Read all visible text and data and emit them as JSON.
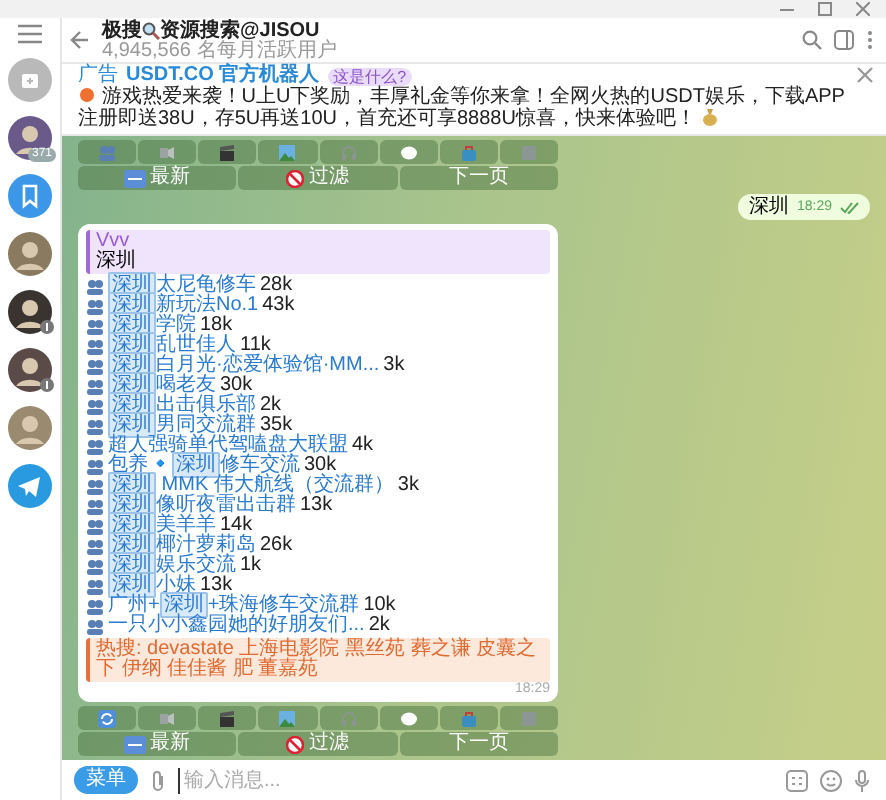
{
  "sidebar": {
    "items": [
      {
        "kind": "archive"
      },
      {
        "kind": "avatar",
        "badge": "371"
      },
      {
        "kind": "saved"
      },
      {
        "kind": "avatar"
      },
      {
        "kind": "avatar",
        "muted": true
      },
      {
        "kind": "avatar",
        "muted": true
      },
      {
        "kind": "avatar"
      },
      {
        "kind": "telegram"
      }
    ]
  },
  "header": {
    "title": [
      "极搜",
      "资源搜索@JISOU"
    ],
    "subtitle": "4,945,566 名每月活跃用户"
  },
  "ad": {
    "label": "广告",
    "name": "USDT.CO 官方机器人",
    "badge": "这是什么?",
    "text": "游戏热爱来袭！U上U下奖励，丰厚礼金等你来拿！全网火热的USDT娱乐，下载APP注册即送38U，存5U再送10U，首充还可享8888U惊喜，快来体验吧！"
  },
  "keyboard_top": {
    "buttons": [
      "最新",
      "过滤",
      "下一页"
    ]
  },
  "outgoing": {
    "text": "深圳",
    "time": "18:29",
    "read": true
  },
  "result": {
    "reply": {
      "author": "Vvv",
      "text": "深圳"
    },
    "items": [
      {
        "match": "深圳",
        "after": "太尼龟修车",
        "count": "28k"
      },
      {
        "match": "深圳",
        "after": "新玩法No.1",
        "count": "43k"
      },
      {
        "match": "深圳",
        "after": "学院",
        "count": "18k"
      },
      {
        "match": "深圳",
        "after": "乱世佳人",
        "count": "11k"
      },
      {
        "match": "深圳",
        "after": "白月光·恋爱体验馆·MM...",
        "count": "3k"
      },
      {
        "match": "深圳",
        "after": "喝老友",
        "count": "30k"
      },
      {
        "match": "深圳",
        "after": "出击俱乐部",
        "count": "2k"
      },
      {
        "match": "深圳",
        "after": "男同交流群",
        "count": "35k"
      },
      {
        "before": "超人强骑单代驾嗑盘大联盟",
        "count": "4k"
      },
      {
        "before": "包养🔹",
        "match": "深圳",
        "after": "修车交流",
        "count": "30k"
      },
      {
        "match": "深圳",
        "after": " MMK 伟大航线（交流群）",
        "count": "3k"
      },
      {
        "match": "深圳",
        "after": "像听夜雷出击群",
        "count": "13k"
      },
      {
        "match": "深圳",
        "after": "美羊羊",
        "count": "14k"
      },
      {
        "match": "深圳",
        "after": "椰汁萝莉岛",
        "count": "26k"
      },
      {
        "match": "深圳",
        "after": "娱乐交流",
        "count": "1k"
      },
      {
        "match": "深圳",
        "after": "小妹",
        "count": "13k"
      },
      {
        "before": "广州+",
        "match": "深圳",
        "after": "+珠海修车交流群",
        "count": "10k"
      },
      {
        "before": "一只小小鑫园她的好朋友们...",
        "count": "2k"
      }
    ],
    "hot": {
      "label": "热搜:",
      "text": "devastate 上海电影院 黑丝苑 葬之谦 皮囊之下 伊纲 佳佳酱 肥 董嘉苑"
    },
    "time": "18:29"
  },
  "keyboard_bottom": {
    "buttons": [
      "最新",
      "过滤",
      "下一页"
    ]
  },
  "input": {
    "menu": "菜单",
    "placeholder": "输入消息..."
  }
}
